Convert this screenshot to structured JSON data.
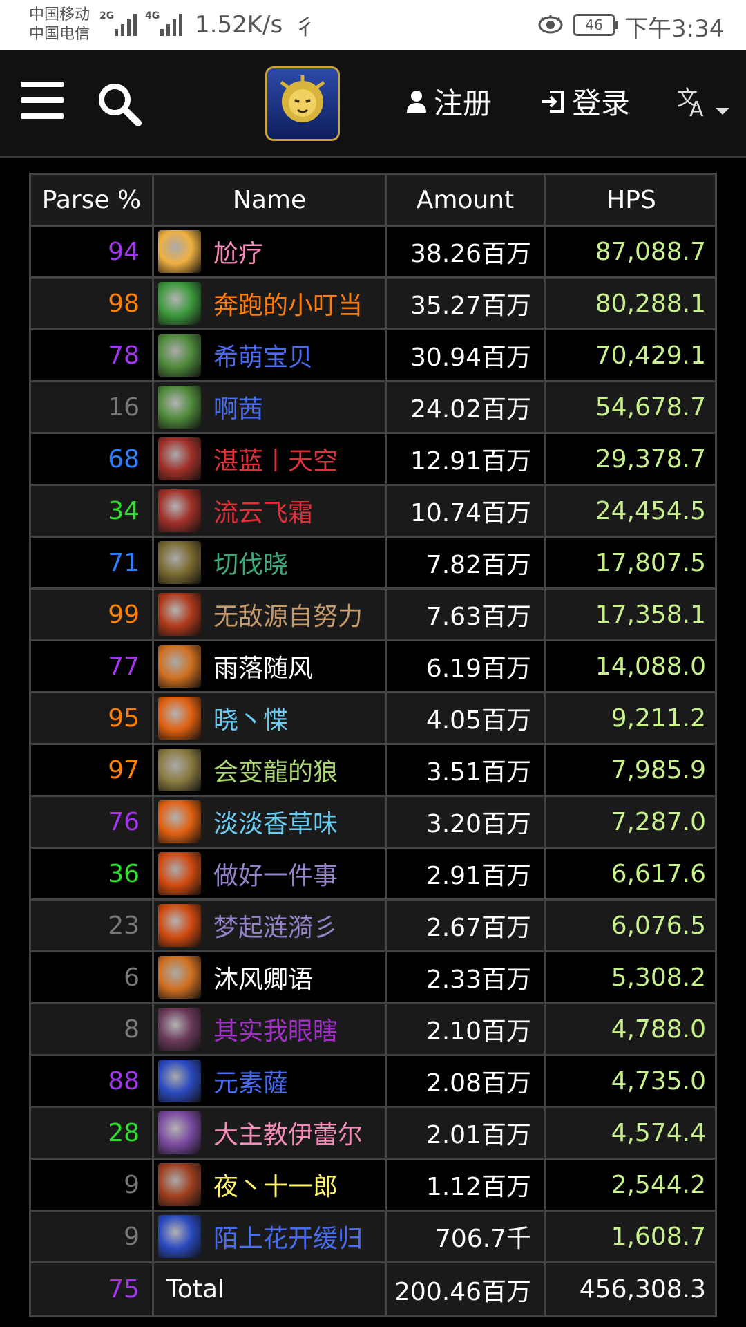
{
  "status_bar": {
    "carrier1": "中国移动",
    "carrier2": "中国电信",
    "sig1_tag": "2G",
    "sig2_tag": "4G",
    "speed": "1.52K/s",
    "battery": "46",
    "time": "下午3:34"
  },
  "nav": {
    "register": "注册",
    "login": "登录"
  },
  "table": {
    "headers": [
      "Parse %",
      "Name",
      "Amount",
      "HPS"
    ],
    "rows": [
      {
        "parse": "94",
        "parse_color": "#a335ee",
        "name": "尬疗",
        "name_color": "#f48cba",
        "amount": "38.26百万",
        "hps": "87,088.7",
        "icon_color": "#f0b040"
      },
      {
        "parse": "98",
        "parse_color": "#ff8000",
        "name": "奔跑的小叮当",
        "name_color": "#ff7c0a",
        "amount": "35.27百万",
        "hps": "80,288.1",
        "icon_color": "#3c9a3c"
      },
      {
        "parse": "78",
        "parse_color": "#a335ee",
        "name": "希萌宝贝",
        "name_color": "#4a6cf0",
        "amount": "30.94百万",
        "hps": "70,429.1",
        "icon_color": "#4f8a3a"
      },
      {
        "parse": "16",
        "parse_color": "#777777",
        "name": "啊茜",
        "name_color": "#4a6cf0",
        "amount": "24.02百万",
        "hps": "54,678.7",
        "icon_color": "#4f8a3a"
      },
      {
        "parse": "68",
        "parse_color": "#2a7fff",
        "name": "湛蓝丨天空",
        "name_color": "#e0303a",
        "amount": "12.91百万",
        "hps": "29,378.7",
        "icon_color": "#a03028"
      },
      {
        "parse": "34",
        "parse_color": "#30e030",
        "name": "流云飞霜",
        "name_color": "#e0303a",
        "amount": "10.74百万",
        "hps": "24,454.5",
        "icon_color": "#a03028"
      },
      {
        "parse": "71",
        "parse_color": "#2a7fff",
        "name": "切伐晓",
        "name_color": "#3fa878",
        "amount": "7.82百万",
        "hps": "17,807.5",
        "icon_color": "#7a6a30"
      },
      {
        "parse": "99",
        "parse_color": "#ff8000",
        "name": "无敌源自努力",
        "name_color": "#c69b6d",
        "amount": "7.63百万",
        "hps": "17,358.1",
        "icon_color": "#b03a1a"
      },
      {
        "parse": "77",
        "parse_color": "#a335ee",
        "name": "雨落随风",
        "name_color": "#ffffff",
        "amount": "6.19百万",
        "hps": "14,088.0",
        "icon_color": "#d07020"
      },
      {
        "parse": "95",
        "parse_color": "#ff8000",
        "name": "晓丶惵",
        "name_color": "#69ccf0",
        "amount": "4.05百万",
        "hps": "9,211.2",
        "icon_color": "#e06010"
      },
      {
        "parse": "97",
        "parse_color": "#ff8000",
        "name": "会变龍的狼",
        "name_color": "#abd473",
        "amount": "3.51百万",
        "hps": "7,985.9",
        "icon_color": "#8a7a40"
      },
      {
        "parse": "76",
        "parse_color": "#a335ee",
        "name": "淡淡香草味",
        "name_color": "#69ccf0",
        "amount": "3.20百万",
        "hps": "7,287.0",
        "icon_color": "#e06010"
      },
      {
        "parse": "36",
        "parse_color": "#30e030",
        "name": "做好一件事",
        "name_color": "#9482c9",
        "amount": "2.91百万",
        "hps": "6,617.6",
        "icon_color": "#d04a10"
      },
      {
        "parse": "23",
        "parse_color": "#777777",
        "name": "梦起涟漪彡",
        "name_color": "#9482c9",
        "amount": "2.67百万",
        "hps": "6,076.5",
        "icon_color": "#d04a10"
      },
      {
        "parse": "6",
        "parse_color": "#777777",
        "name": "沐风卿语",
        "name_color": "#ffffff",
        "amount": "2.33百万",
        "hps": "5,308.2",
        "icon_color": "#d07020"
      },
      {
        "parse": "8",
        "parse_color": "#777777",
        "name": "其实我眼瞎",
        "name_color": "#a330c9",
        "amount": "2.10百万",
        "hps": "4,788.0",
        "icon_color": "#6a3a5a"
      },
      {
        "parse": "88",
        "parse_color": "#a335ee",
        "name": "元素薩",
        "name_color": "#4a6cf0",
        "amount": "2.08百万",
        "hps": "4,735.0",
        "icon_color": "#2a4ac0"
      },
      {
        "parse": "28",
        "parse_color": "#30e030",
        "name": "大主教伊蕾尔",
        "name_color": "#f48cba",
        "amount": "2.01百万",
        "hps": "4,574.4",
        "icon_color": "#7a4aa0"
      },
      {
        "parse": "9",
        "parse_color": "#777777",
        "name": "夜丶十一郎",
        "name_color": "#fff468",
        "amount": "1.12百万",
        "hps": "2,544.2",
        "icon_color": "#a04020"
      },
      {
        "parse": "9",
        "parse_color": "#777777",
        "name": "陌上花开缓归",
        "name_color": "#4a6cf0",
        "amount": "706.7千",
        "hps": "1,608.7",
        "icon_color": "#2a4ac0"
      }
    ],
    "total": {
      "parse": "75",
      "parse_color": "#a335ee",
      "name": "Total",
      "amount": "200.46百万",
      "hps": "456,308.3"
    }
  }
}
